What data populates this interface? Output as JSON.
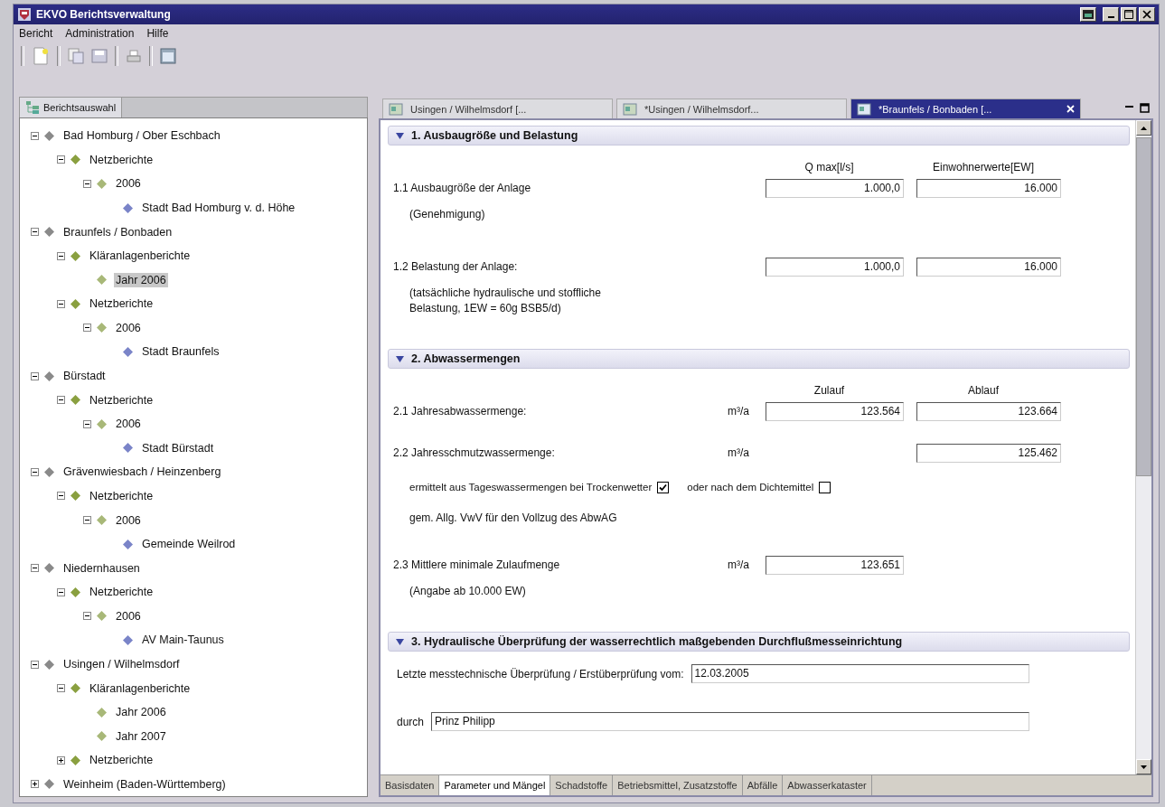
{
  "window": {
    "title": "EKVO Berichtsverwaltung"
  },
  "menu": [
    "Bericht",
    "Administration",
    "Hilfe"
  ],
  "sidebar": {
    "tab": "Berichtsauswahl",
    "tree": [
      {
        "label": "Bad Homburg / Ober Eschbach",
        "selected": false,
        "expanded": true,
        "children": [
          {
            "label": "Netzberichte",
            "selected": false,
            "expanded": true,
            "children": [
              {
                "label": "2006",
                "selected": false,
                "expanded": true,
                "children": [
                  {
                    "label": "Stadt Bad Homburg v. d. Höhe",
                    "selected": false
                  }
                ]
              }
            ]
          }
        ]
      },
      {
        "label": "Braunfels / Bonbaden",
        "selected": false,
        "expanded": true,
        "children": [
          {
            "label": "Kläranlagenberichte",
            "selected": false,
            "expanded": true,
            "children": [
              {
                "label": "Jahr 2006",
                "selected": true
              }
            ]
          },
          {
            "label": "Netzberichte",
            "selected": false,
            "expanded": true,
            "children": [
              {
                "label": "2006",
                "selected": false,
                "expanded": true,
                "children": [
                  {
                    "label": "Stadt Braunfels",
                    "selected": false
                  }
                ]
              }
            ]
          }
        ]
      },
      {
        "label": "Bürstadt",
        "selected": false,
        "expanded": true,
        "children": [
          {
            "label": "Netzberichte",
            "selected": false,
            "expanded": true,
            "children": [
              {
                "label": "2006",
                "selected": false,
                "expanded": true,
                "children": [
                  {
                    "label": "Stadt Bürstadt",
                    "selected": false
                  }
                ]
              }
            ]
          }
        ]
      },
      {
        "label": "Grävenwiesbach / Heinzenberg",
        "selected": false,
        "expanded": true,
        "children": [
          {
            "label": "Netzberichte",
            "selected": false,
            "expanded": true,
            "children": [
              {
                "label": "2006",
                "selected": false,
                "expanded": true,
                "children": [
                  {
                    "label": "Gemeinde Weilrod",
                    "selected": false
                  }
                ]
              }
            ]
          }
        ]
      },
      {
        "label": "Niedernhausen",
        "selected": false,
        "expanded": true,
        "children": [
          {
            "label": "Netzberichte",
            "selected": false,
            "expanded": true,
            "children": [
              {
                "label": "2006",
                "selected": false,
                "expanded": true,
                "children": [
                  {
                    "label": "AV Main-Taunus",
                    "selected": false
                  }
                ]
              }
            ]
          }
        ]
      },
      {
        "label": "Usingen / Wilhelmsdorf",
        "selected": false,
        "expanded": true,
        "children": [
          {
            "label": "Kläranlagenberichte",
            "selected": false,
            "expanded": true,
            "children": [
              {
                "label": "Jahr 2006",
                "selected": false
              },
              {
                "label": "Jahr 2007",
                "selected": false
              }
            ]
          },
          {
            "label": "Netzberichte",
            "selected": false,
            "expanded": false
          }
        ]
      },
      {
        "label": "Weinheim (Baden-Württemberg)",
        "selected": false,
        "expanded": false
      }
    ]
  },
  "tabs": [
    {
      "label": "Usingen / Wilhelmsdorf [...",
      "selected": false
    },
    {
      "label": "*Usingen / Wilhelmsdorf...",
      "selected": false
    },
    {
      "label": "*Braunfels / Bonbaden [...",
      "selected": true
    }
  ],
  "form": {
    "sections": [
      {
        "title": "1. Ausbaugröße und Belastung",
        "expanded": true,
        "rows": [
          {
            "kind": "column-heads",
            "labels": [
              "Q max[l/s]",
              "Einwohnerwerte[EW]"
            ]
          },
          {
            "kind": "quantity",
            "label": "1.1 Ausbaugröße der Anlage",
            "note": "(Genehmigung)",
            "values": [
              "1.000,0",
              "16.000"
            ]
          },
          {
            "kind": "quantity",
            "label": "1.2 Belastung der Anlage:",
            "note": "(tatsächliche hydraulische und stoffliche Belastung, 1EW = 60g BSB5/d)",
            "values": [
              "1.000,0",
              "16.000"
            ]
          }
        ]
      },
      {
        "title": "2. Abwassermengen",
        "expanded": true,
        "rows": [
          {
            "kind": "column-heads",
            "labels": [
              "Zulauf",
              "Ablauf"
            ]
          },
          {
            "kind": "quantity",
            "label": "2.1 Jahresabwassermenge:",
            "unit": "m³/a",
            "values": [
              "123.564",
              "123.664"
            ]
          },
          {
            "kind": "quantity",
            "label": "2.2 Jahresschmutzwassermenge:",
            "unit": "m³/a",
            "first_column_empty": true,
            "values": [
              "125.462"
            ]
          },
          {
            "kind": "checks",
            "items": [
              {
                "label": "ermittelt aus Tageswassermengen bei Trockenwetter",
                "checked": true
              },
              {
                "label": "oder nach dem Dichtemittel",
                "checked": false
              }
            ]
          },
          {
            "kind": "note",
            "text": "gem. Allg. VwV für den Vollzug des AbwAG"
          },
          {
            "kind": "quantity",
            "label": "2.3 Mittlere minimale Zulaufmenge",
            "note": "(Angabe ab 10.000 EW)",
            "unit": "m³/a",
            "values": [
              "123.651"
            ]
          }
        ]
      },
      {
        "title": "3. Hydraulische Überprüfung der wasserrechtlich maßgebenden Durchflußmesseinrichtung",
        "expanded": true,
        "rows": [
          {
            "kind": "labeled-field",
            "label": "Letzte messtechnische Überprüfung / Erstüberprüfung vom:",
            "value": "12.03.2005"
          },
          {
            "kind": "labeled-field",
            "label": "durch",
            "value": "Prinz Philipp"
          }
        ]
      }
    ]
  },
  "bottom_tabs": [
    {
      "label": "Basisdaten",
      "selected": false
    },
    {
      "label": "Parameter und Mängel",
      "selected": true
    },
    {
      "label": "Schadstoffe",
      "selected": false
    },
    {
      "label": "Betriebsmittel, Zusatzstoffe",
      "selected": false
    },
    {
      "label": "Abfälle",
      "selected": false
    },
    {
      "label": "Abwasserkataster",
      "selected": false
    }
  ]
}
